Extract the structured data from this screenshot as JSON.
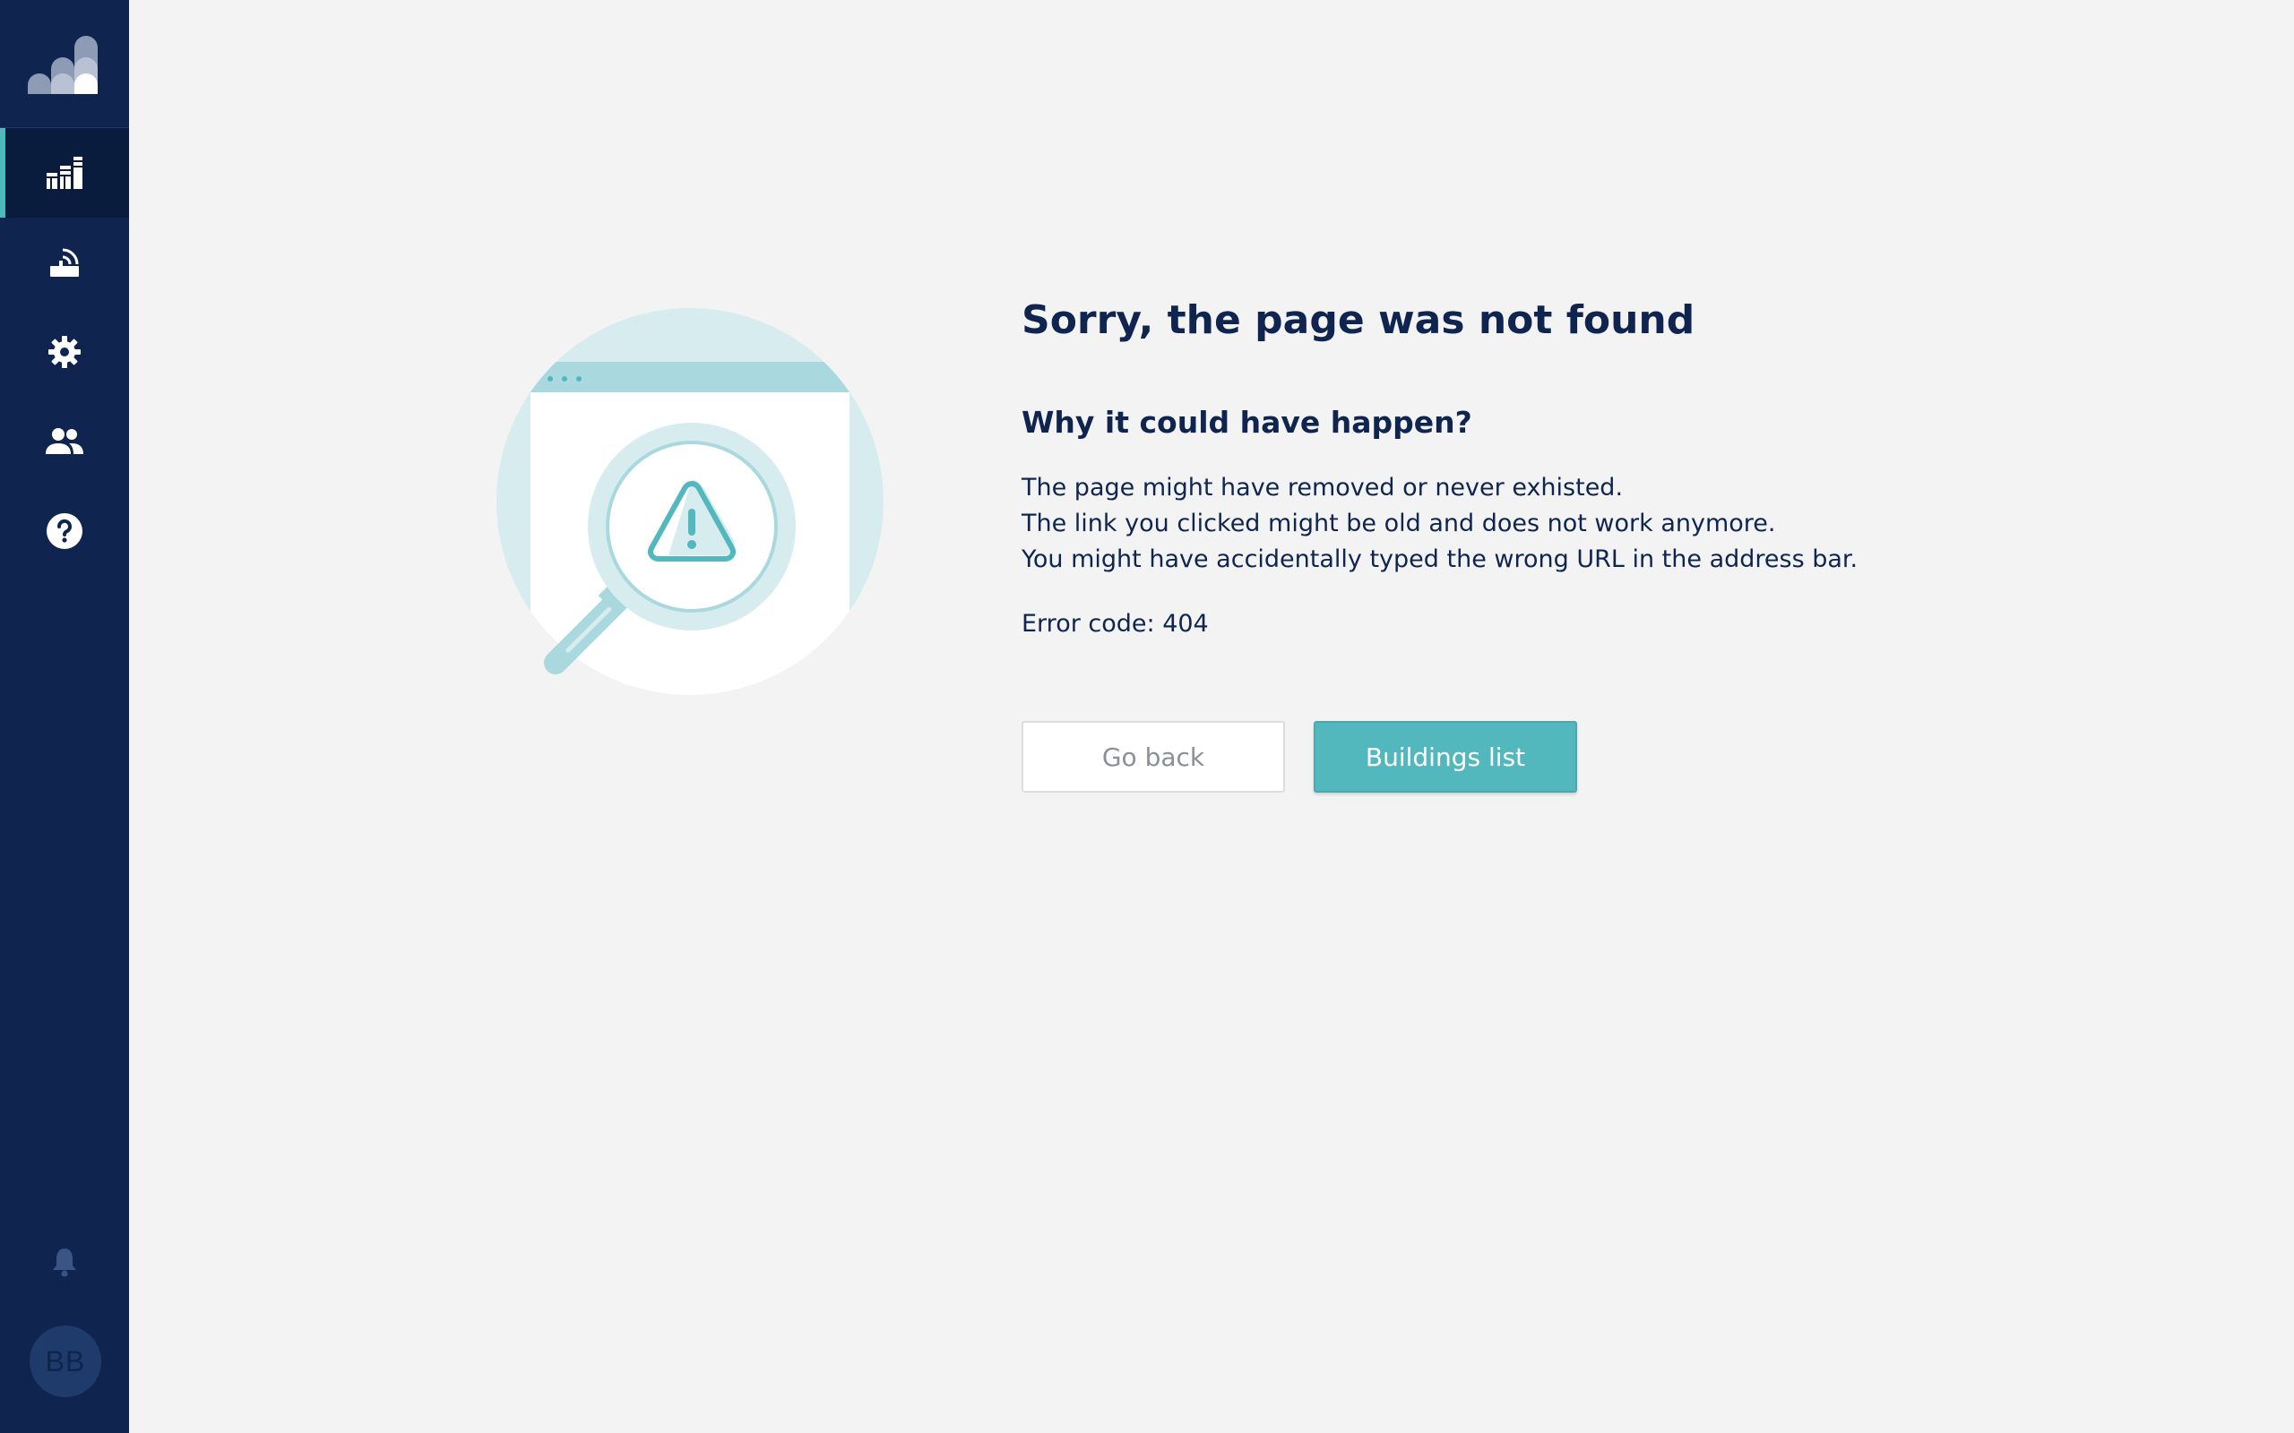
{
  "app": {
    "logo": "buildings-logo"
  },
  "sidebar": {
    "items": [
      {
        "icon": "buildings-icon",
        "active": true
      },
      {
        "icon": "gateway-icon",
        "active": false
      },
      {
        "icon": "gear-icon",
        "active": false
      },
      {
        "icon": "users-icon",
        "active": false
      },
      {
        "icon": "help-icon",
        "active": false
      }
    ],
    "bell_icon": "bell-icon",
    "avatar_initials": "BB"
  },
  "error_page": {
    "title": "Sorry, the page was not found",
    "subtitle": "Why it could have happen?",
    "reasons": [
      "The page might have removed or never exhisted.",
      "The link you clicked might be old and does not work anymore.",
      "You might have accidentally typed the wrong URL in the address bar."
    ],
    "error_code": "Error code: 404",
    "buttons": {
      "back_label": "Go back",
      "primary_label": "Buildings list"
    }
  },
  "colors": {
    "sidebar": "#0f2550",
    "accent": "#53b8bd",
    "text": "#0f2550",
    "background": "#f3f3f3"
  }
}
